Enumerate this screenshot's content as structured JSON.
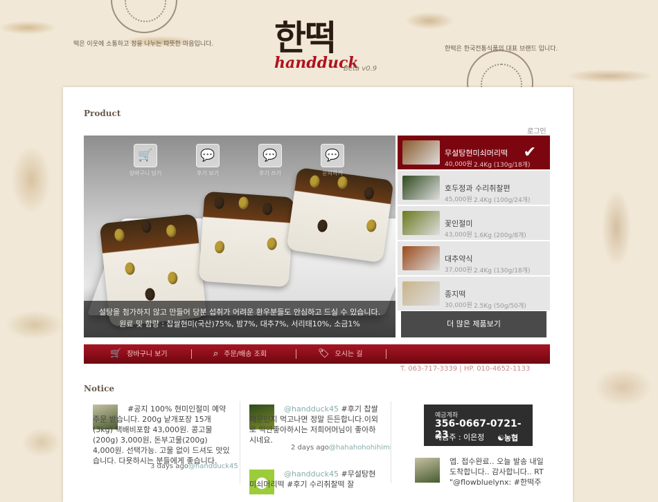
{
  "header": {
    "logo_ko": "한떡",
    "logo_en": "handduck",
    "version": "Beta v0.9",
    "tagline_left": "떡은 이웃에 소통하고 정을 나누는 따뜻한 마음입니다.",
    "tagline_right": "한떡은 한국전통식품의 대표 브랜드 입니다."
  },
  "product_section": {
    "title": "Product",
    "login": "로그인",
    "hero_icons": [
      {
        "icon": "cart-icon",
        "label": "장바구니 담기"
      },
      {
        "icon": "comment-icon",
        "label": "후기 보기"
      },
      {
        "icon": "comment-plus-icon",
        "label": "후기 쓰기"
      },
      {
        "icon": "comment-question-icon",
        "label": "문의하기"
      }
    ],
    "hero_caption_line1": "설탕을 첨가하지 않고 만들어 당분 섭취가 어려운 환우분들도 안심하고 드실 수 있습니다.",
    "hero_caption_line2": "원료 및 함량 : 찹쌀현미(국산)75%, 밤7%, 대추7%, 서리태10%, 소금1%",
    "products": [
      {
        "name": "무설탕현미쇠머리떡",
        "price": "40,000원",
        "weight": "2.4Kg (130g/18개)",
        "thumb": "#8b5a2b",
        "selected": true
      },
      {
        "name": "호두정과 수리취찰편",
        "price": "45,000원",
        "weight": "2.4Kg (100g/24개)",
        "thumb": "#2f4a1e",
        "selected": false
      },
      {
        "name": "꽃인절미",
        "price": "43,000원",
        "weight": "1.6Kg (200g/8개)",
        "thumb": "#6a7a1e",
        "selected": false
      },
      {
        "name": "대추약식",
        "price": "37,000원",
        "weight": "2.4Kg (130g/18개)",
        "thumb": "#9a4a1a",
        "selected": false
      },
      {
        "name": "종지떡",
        "price": "30,000원",
        "weight": "2.5Kg (50g/50개)",
        "thumb": "#c9b48a",
        "selected": false
      }
    ],
    "more_button": "더 많은 제품보기"
  },
  "nav": {
    "items": [
      {
        "icon": "cart-icon",
        "label": "장바구니 보기"
      },
      {
        "icon": "search-icon",
        "label": "주문/배송 조회"
      },
      {
        "icon": "tag-icon",
        "label": "오시는 길"
      }
    ],
    "contact": "T. 063-717-3339 | HP. 010-4652-1133"
  },
  "notice_section": {
    "title": "Notice",
    "posts": [
      {
        "text": "#공지 100% 현미인절미 예약주문 받습니다. 200g 낱개포장 15개(3kg) 택배비포함 43,000원. 콩고물(200g) 3,000원, 돈부고물(200g) 4,000원. 선택가능. 고물 없이 드셔도 맛있습니다. 다욧하시는 분들에게 좋습니다.",
        "time": "3 days ago",
        "user": "@handduck45"
      },
      {
        "handle": "@handduck45",
        "text": "#후기 찹쌀때문인지 먹고나면 정말 든든합니다.이외로 떡안좋아하시는 저희어머님이 좋아하시네요.",
        "time": "2 days ago",
        "user": "@hahahohohihimi"
      },
      {
        "handle": "@handduck45",
        "text": "#무설탕현미쇠머리떡 #후기 수리취찰떡 잘"
      }
    ],
    "account": {
      "label": "예금계좌",
      "number": "356-0667-0721-23",
      "holder": "예금주 : 이은정",
      "bank": "농협"
    },
    "reply": "엡. 접수완료.. 오늘 발송 내일 도착합니다.. 감사합니다.. RT \"@flowbluelynx: #한떡주"
  }
}
